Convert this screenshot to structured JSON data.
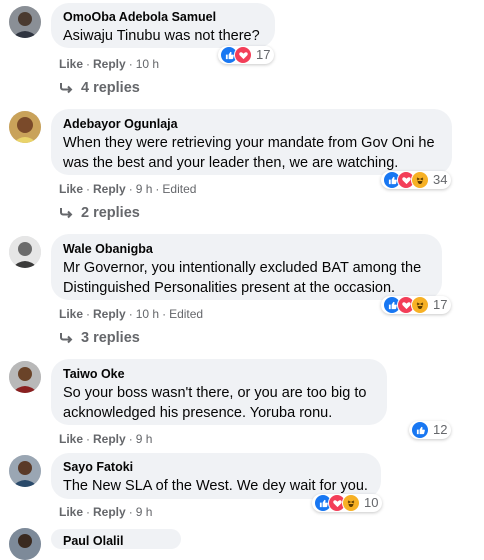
{
  "actions": {
    "like": "Like",
    "reply": "Reply",
    "separator": "·"
  },
  "comments": [
    {
      "author": "OmoOba Adebola Samuel",
      "text": "Asiwaju Tinubu was not there?",
      "time": "10 h",
      "edited": "",
      "reaction_count": "17",
      "reactions": [
        "like",
        "love"
      ],
      "replies": "4 replies"
    },
    {
      "author": "Adebayor Ogunlaja",
      "text": "When they were retrieving your mandate from Gov Oni he was the best and your leader then, we are watching.",
      "time": "9 h",
      "edited": "Edited",
      "reaction_count": "34",
      "reactions": [
        "like",
        "love",
        "haha"
      ],
      "replies": "2 replies"
    },
    {
      "author": "Wale Obanigba",
      "text": "Mr Governor, you intentionally excluded BAT among the Distinguished Personalities present at the occasion.",
      "time": "10 h",
      "edited": "Edited",
      "reaction_count": "17",
      "reactions": [
        "like",
        "love",
        "haha"
      ],
      "replies": "3 replies"
    },
    {
      "author": "Taiwo Oke",
      "text": "So your boss wasn't there, or you are too big to acknowledged his presence. Yoruba ronu.",
      "time": "9 h",
      "edited": "",
      "reaction_count": "12",
      "reactions": [
        "like"
      ],
      "replies": ""
    },
    {
      "author": "Sayo Fatoki",
      "text": "The New SLA of the West. We dey wait for you.",
      "time": "9 h",
      "edited": "",
      "reaction_count": "10",
      "reactions": [
        "like",
        "love",
        "haha"
      ],
      "replies": ""
    }
  ],
  "partial_author": "Paul Olalil"
}
